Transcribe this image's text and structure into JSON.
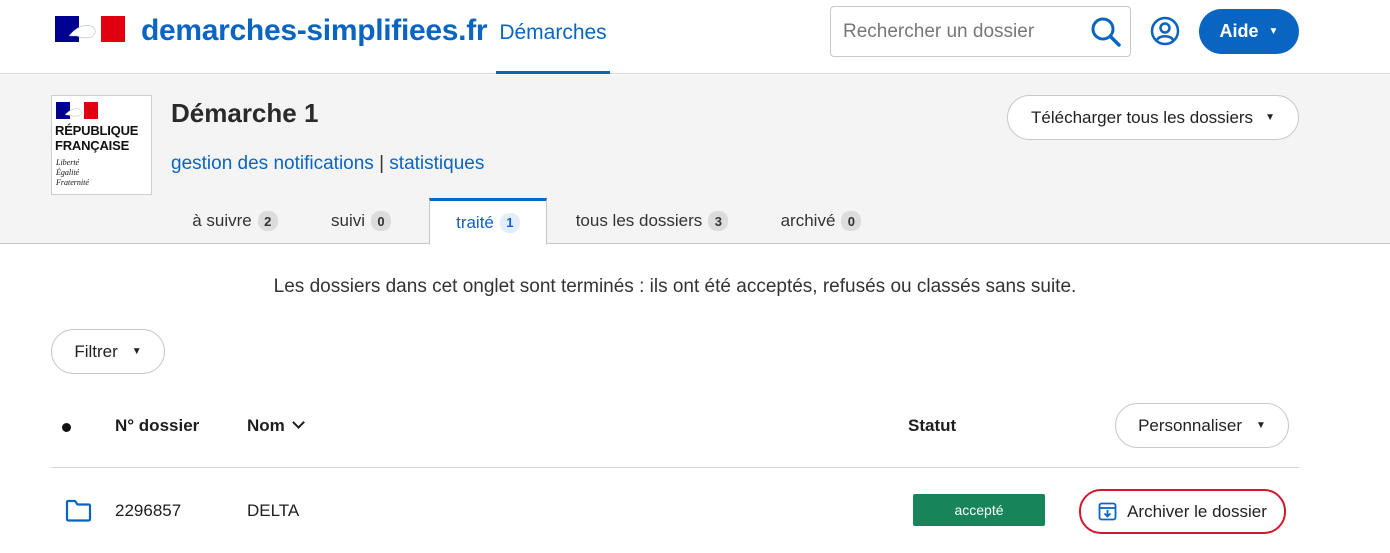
{
  "header": {
    "site_title": "demarches-simplifiees.fr",
    "nav_link": "Démarches",
    "search_placeholder": "Rechercher un dossier",
    "help_button": "Aide",
    "brand_color": "#0a65c2"
  },
  "procedure": {
    "logo_line1": "RÉPUBLIQUE",
    "logo_line2": "FRANÇAISE",
    "logo_motto": [
      "Liberté",
      "Égalité",
      "Fraternité"
    ],
    "title": "Démarche 1",
    "link_notifications": "gestion des notifications",
    "separator": "|",
    "link_stats": "statistiques",
    "download_button": "Télécharger tous les dossiers"
  },
  "tabs": [
    {
      "label": "à suivre",
      "count": "2",
      "active": false
    },
    {
      "label": "suivi",
      "count": "0",
      "active": false
    },
    {
      "label": "traité",
      "count": "1",
      "active": true
    },
    {
      "label": "tous les dossiers",
      "count": "3",
      "active": false
    },
    {
      "label": "archivé",
      "count": "0",
      "active": false
    }
  ],
  "content": {
    "info_text": "Les dossiers dans cet onglet sont terminés : ils ont été acceptés, refusés ou classés sans suite.",
    "filter_button": "Filtrer",
    "customize_button": "Personnaliser"
  },
  "table": {
    "columns": {
      "number": "N° dossier",
      "name": "Nom",
      "status": "Statut"
    },
    "rows": [
      {
        "number": "2296857",
        "name": "DELTA",
        "status": "accepté",
        "status_color": "#18845a",
        "action": "Archiver le dossier"
      }
    ]
  }
}
